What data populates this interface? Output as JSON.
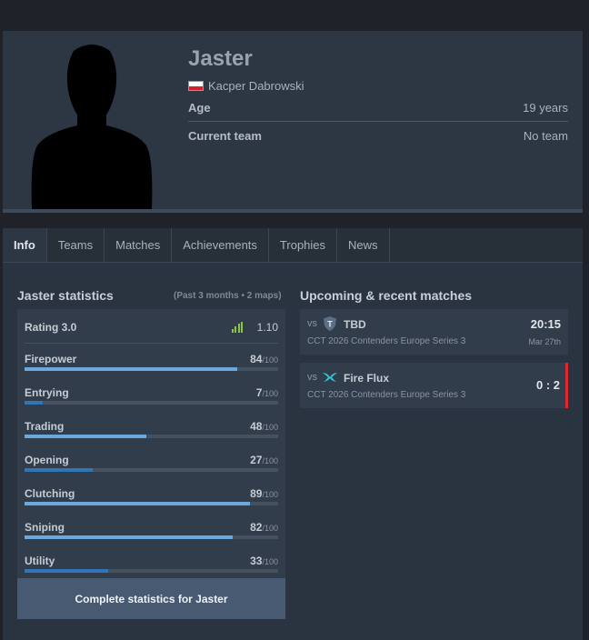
{
  "player": {
    "nickname": "Jaster",
    "real_name": "Kacper Dabrowski",
    "flag": "poland-flag",
    "age_label": "Age",
    "age_value": "19 years",
    "team_label": "Current team",
    "team_value": "No team"
  },
  "tabs": [
    {
      "label": "Info",
      "active": true
    },
    {
      "label": "Teams",
      "active": false
    },
    {
      "label": "Matches",
      "active": false
    },
    {
      "label": "Achievements",
      "active": false
    },
    {
      "label": "Trophies",
      "active": false
    },
    {
      "label": "News",
      "active": false
    }
  ],
  "statistics": {
    "title": "Jaster statistics",
    "period": "(Past 3 months • 2 maps)",
    "rating_label": "Rating 3.0",
    "rating_value": "1.10",
    "max_label": "/100",
    "items": [
      {
        "name": "Firepower",
        "value": "84",
        "percent": 84
      },
      {
        "name": "Entrying",
        "value": "7",
        "percent": 7
      },
      {
        "name": "Trading",
        "value": "48",
        "percent": 48
      },
      {
        "name": "Opening",
        "value": "27",
        "percent": 27
      },
      {
        "name": "Clutching",
        "value": "89",
        "percent": 89
      },
      {
        "name": "Sniping",
        "value": "82",
        "percent": 82
      },
      {
        "name": "Utility",
        "value": "33",
        "percent": 33
      }
    ],
    "complete_button": "Complete statistics for Jaster"
  },
  "matches": {
    "title": "Upcoming & recent matches",
    "items": [
      {
        "vs": "vs",
        "team": "TBD",
        "event": "CCT 2026 Contenders Europe Series 3",
        "time": "20:15",
        "date": "Mar 27th",
        "icon": "tbd-shield-icon"
      },
      {
        "vs": "vs",
        "team": "Fire Flux",
        "event": "CCT 2026 Contenders Europe Series 3",
        "score": "0 : 2",
        "icon": "fire-flux-logo-icon"
      }
    ]
  },
  "colors": {
    "bar_high": "#6aa9e0",
    "bar_low": "#2f75b8",
    "loss": "#e0262f",
    "rating_icon": "#8ec63f"
  }
}
